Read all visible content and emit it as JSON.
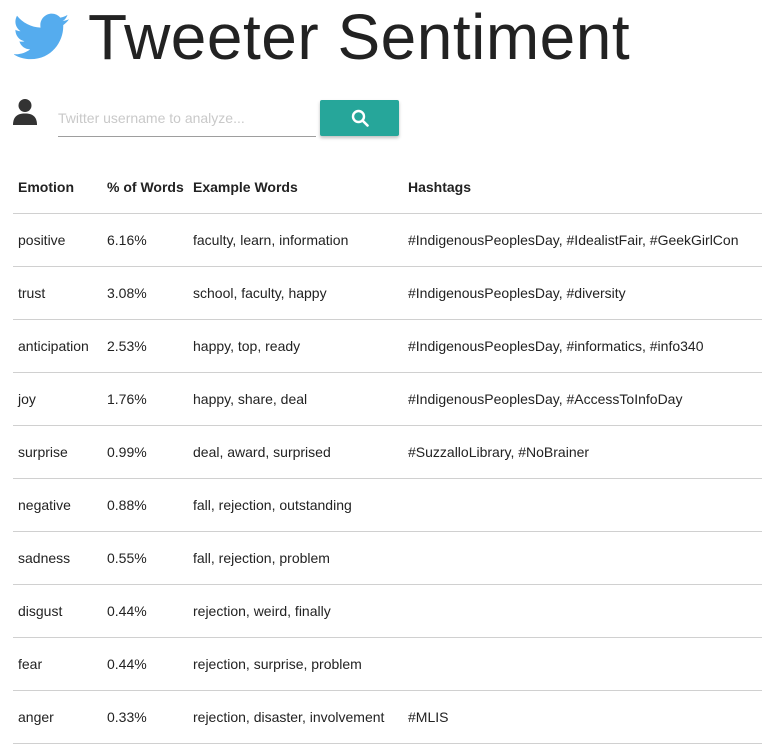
{
  "app": {
    "title": "Tweeter Sentiment",
    "logo_icon": "twitter-bird-icon",
    "brand_color": "#55acee"
  },
  "search": {
    "user_icon": "user-icon",
    "placeholder": "Twitter username to analyze...",
    "value": "",
    "button_icon": "search-icon",
    "button_color": "#26a69a"
  },
  "table": {
    "headers": {
      "emotion": "Emotion",
      "percent": "% of Words",
      "examples": "Example Words",
      "hashtags": "Hashtags"
    },
    "rows": [
      {
        "emotion": "positive",
        "percent": "6.16%",
        "examples": "faculty, learn, information",
        "hashtags": "#IndigenousPeoplesDay, #IdealistFair, #GeekGirlCon"
      },
      {
        "emotion": "trust",
        "percent": "3.08%",
        "examples": "school, faculty, happy",
        "hashtags": "#IndigenousPeoplesDay, #diversity"
      },
      {
        "emotion": "anticipation",
        "percent": "2.53%",
        "examples": "happy, top, ready",
        "hashtags": "#IndigenousPeoplesDay, #informatics, #info340"
      },
      {
        "emotion": "joy",
        "percent": "1.76%",
        "examples": "happy, share, deal",
        "hashtags": "#IndigenousPeoplesDay, #AccessToInfoDay"
      },
      {
        "emotion": "surprise",
        "percent": "0.99%",
        "examples": "deal, award, surprised",
        "hashtags": "#SuzzalloLibrary, #NoBrainer"
      },
      {
        "emotion": "negative",
        "percent": "0.88%",
        "examples": "fall, rejection, outstanding",
        "hashtags": ""
      },
      {
        "emotion": "sadness",
        "percent": "0.55%",
        "examples": "fall, rejection, problem",
        "hashtags": ""
      },
      {
        "emotion": "disgust",
        "percent": "0.44%",
        "examples": "rejection, weird, finally",
        "hashtags": ""
      },
      {
        "emotion": "fear",
        "percent": "0.44%",
        "examples": "rejection, surprise, problem",
        "hashtags": ""
      },
      {
        "emotion": "anger",
        "percent": "0.33%",
        "examples": "rejection, disaster, involvement",
        "hashtags": "#MLIS"
      }
    ]
  }
}
